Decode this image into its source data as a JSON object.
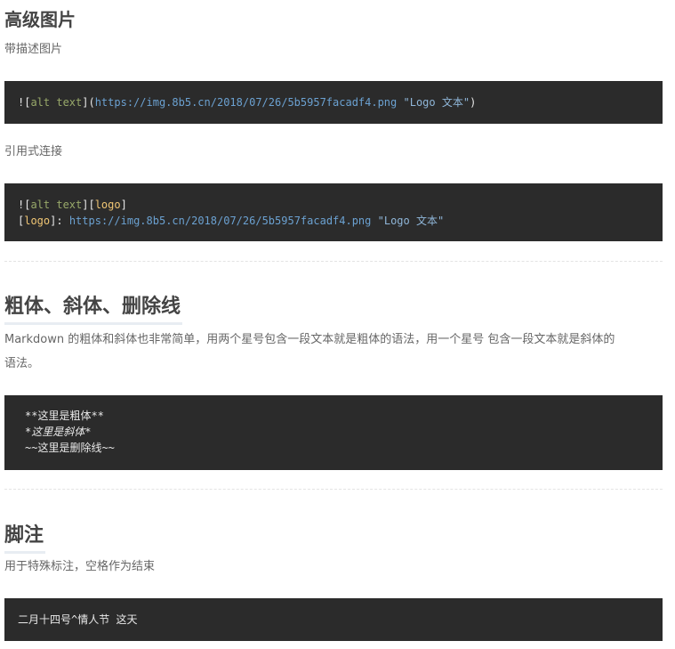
{
  "section_image": {
    "title": "高级图片",
    "desc": "带描述图片",
    "code1": {
      "bang_open": "![",
      "alt": "alt text",
      "mid": "](",
      "url": "https://img.8b5.cn/2018/07/26/5b5957facadf4.png",
      "title": "\"Logo 文本\"",
      "close": ")"
    },
    "ref_desc": "引用式连接",
    "code2": {
      "line1_open": "![",
      "line1_alt": "alt text",
      "line1_mid": "][",
      "line1_ref": "logo",
      "line1_close": "]",
      "line2_open": "[",
      "line2_ref": "logo",
      "line2_mid": "]: ",
      "line2_url": "https://img.8b5.cn/2018/07/26/5b5957facadf4.png",
      "line2_title": "\"Logo 文本\""
    }
  },
  "section_emphasis": {
    "title": "粗体、斜体、删除线",
    "desc_line1": "Markdown 的粗体和斜体也非常简单，用两个星号包含一段文本就是粗体的语法，用一个星号 包含一段文本就是斜体的",
    "desc_line2": "语法。",
    "code": {
      "bold": "**这里是粗体**",
      "italic": "*这里是斜体*",
      "strike": "~~这里是删除线~~"
    }
  },
  "section_footnote": {
    "title": "脚注",
    "desc": "用于特殊标注，空格作为结束",
    "code": "二月十四号^情人节 这天"
  }
}
